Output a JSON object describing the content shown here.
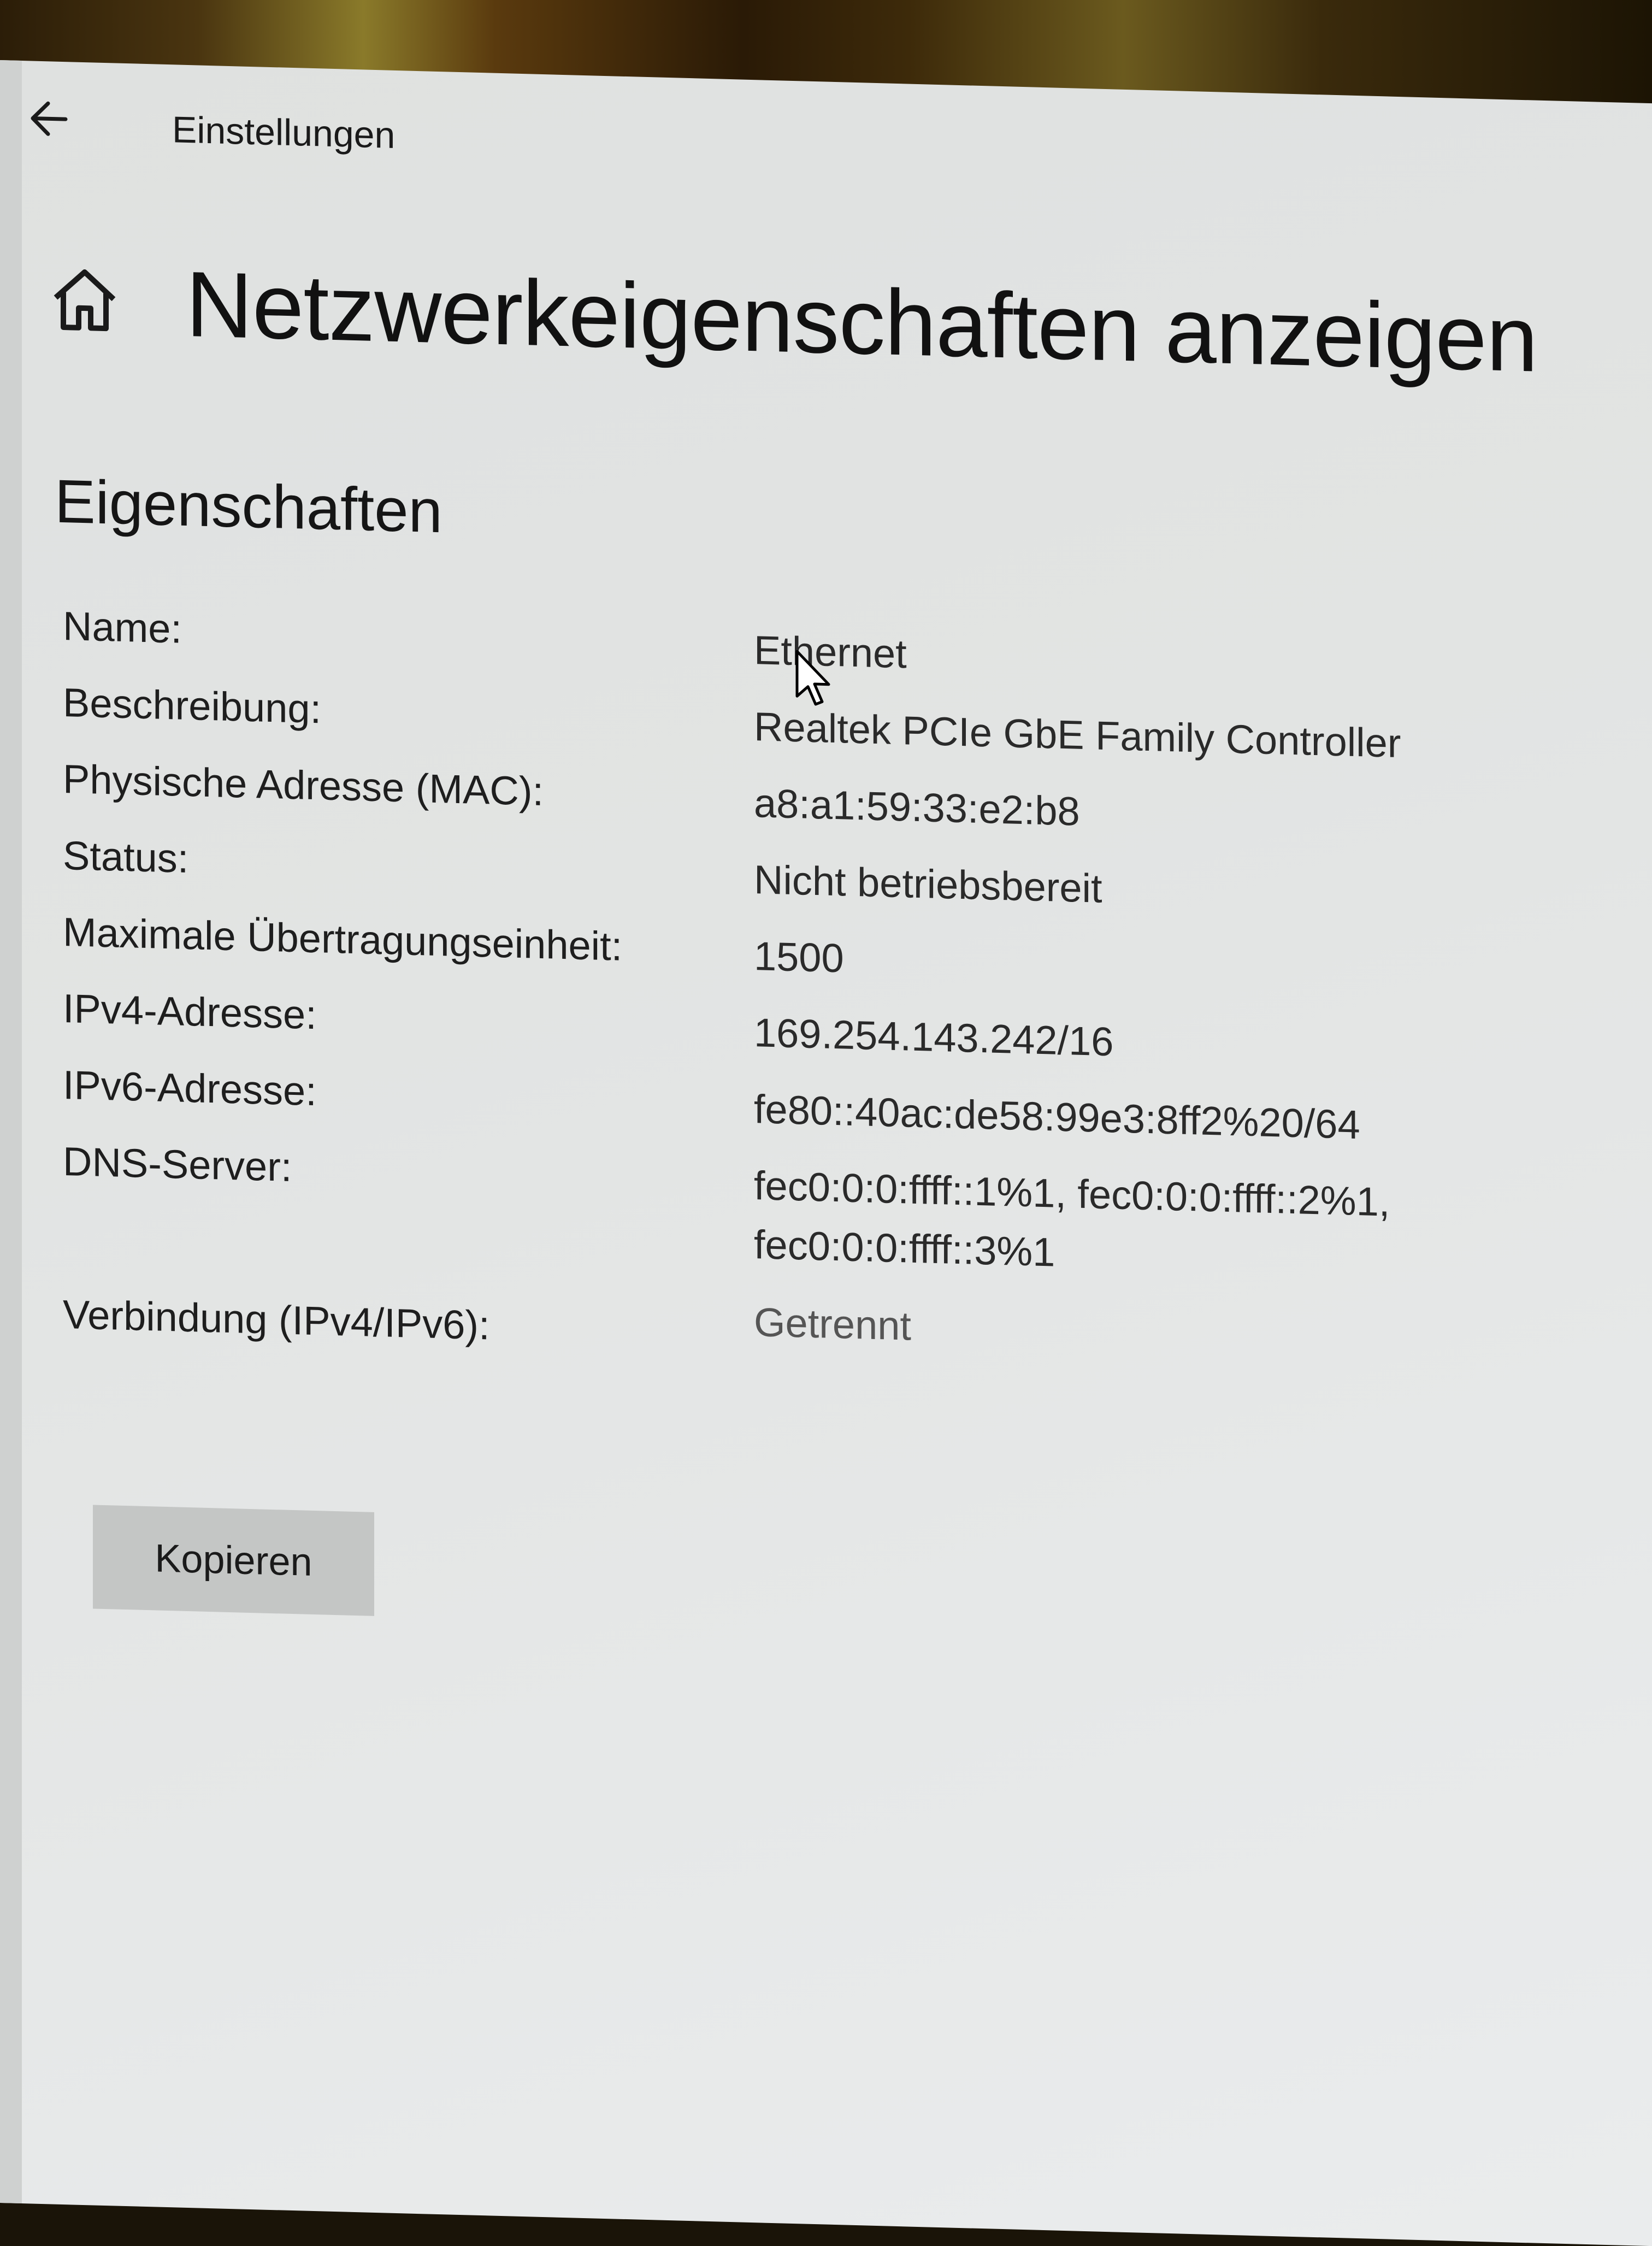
{
  "window": {
    "app_title": "Einstellungen"
  },
  "page": {
    "title": "Netzwerkeigenschaften anzeigen",
    "section_title": "Eigenschaften"
  },
  "properties": [
    {
      "label": "Name:",
      "value": "Ethernet"
    },
    {
      "label": "Beschreibung:",
      "value": "Realtek PCIe GbE Family Controller"
    },
    {
      "label": "Physische Adresse (MAC):",
      "value": "a8:a1:59:33:e2:b8"
    },
    {
      "label": "Status:",
      "value": "Nicht betriebsbereit"
    },
    {
      "label": "Maximale Übertragungseinheit:",
      "value": "1500"
    },
    {
      "label": "IPv4-Adresse:",
      "value": "169.254.143.242/16"
    },
    {
      "label": "IPv6-Adresse:",
      "value": "fe80::40ac:de58:99e3:8ff2%20/64"
    },
    {
      "label": "DNS-Server:",
      "value": "fec0:0:0:ffff::1%1, fec0:0:0:ffff::2%1,",
      "value2": "fec0:0:0:ffff::3%1"
    },
    {
      "label": "Verbindung (IPv4/IPv6):",
      "value": "Getrennt"
    }
  ],
  "actions": {
    "copy_label": "Kopieren"
  },
  "icons": {
    "back": "back-arrow-icon",
    "home": "home-icon",
    "cursor": "mouse-cursor-icon"
  }
}
